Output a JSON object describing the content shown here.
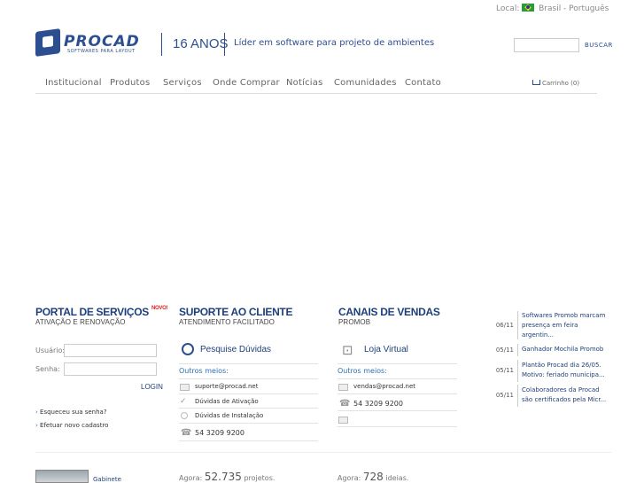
{
  "header": {
    "locale_label": "Local:",
    "locale_value": "Brasil - Português",
    "logo_word": "PROCAD",
    "logo_tagline": "SOFTWARES PARA LAYOUT",
    "anos": "16 ANOS",
    "slogan": "Líder em software para projeto de ambientes",
    "search_placeholder": "",
    "search_button": "BUSCAR"
  },
  "nav": {
    "items": [
      "Institucional",
      "Produtos",
      "Serviços",
      "Onde Comprar",
      "Notícias",
      "Comunidades",
      "Contato"
    ],
    "cart": "Carrinho (0)"
  },
  "portal": {
    "title": "PORTAL DE SERVIÇOS",
    "badge": "NOVO!",
    "subtitle": "ATIVAÇÃO E RENOVAÇÃO",
    "user_label": "Usuário:",
    "pass_label": "Senha:",
    "login": "LOGIN",
    "forgot": "Esqueceu sua senha?",
    "register": "Efetuar novo cadastro"
  },
  "support": {
    "title": "SUPORTE AO CLIENTE",
    "subtitle": "ATENDIMENTO FACILITADO",
    "search": "Pesquise Dúvidas",
    "other": "Outros meios:",
    "email": "suporte@procad.net",
    "activation": "Dúvidas de Ativação",
    "install": "Dúvidas de Instalação",
    "phone": "54 3209 9200"
  },
  "sales": {
    "title": "CANAIS DE VENDAS",
    "subtitle": "PROMOB",
    "store": "Loja Virtual",
    "other": "Outros meios:",
    "email": "vendas@procad.net",
    "phone": "54 3209 9200"
  },
  "news": [
    {
      "date": "06/11",
      "text": "Softwares Promob marcam presença em feira argentin..."
    },
    {
      "date": "05/11",
      "text": "Ganhador Mochila Promob"
    },
    {
      "date": "05/11",
      "text": "Plantão Procad dia 26/05. Motivo: feriado municipa..."
    },
    {
      "date": "05/11",
      "text": "Colaboradores da Procad são certificados pela Micr..."
    }
  ],
  "footer": {
    "gabinete": "Gabinete",
    "agora1_pre": "Agora:",
    "agora1_num": "52.735",
    "agora1_suf": "projetos.",
    "agora2_pre": "Agora:",
    "agora2_num": "728",
    "agora2_suf": "ideias."
  },
  "colors": {
    "brand_blue": "#2d4f8f",
    "link_blue": "#2d6fb5",
    "novo_red": "#d22222"
  }
}
